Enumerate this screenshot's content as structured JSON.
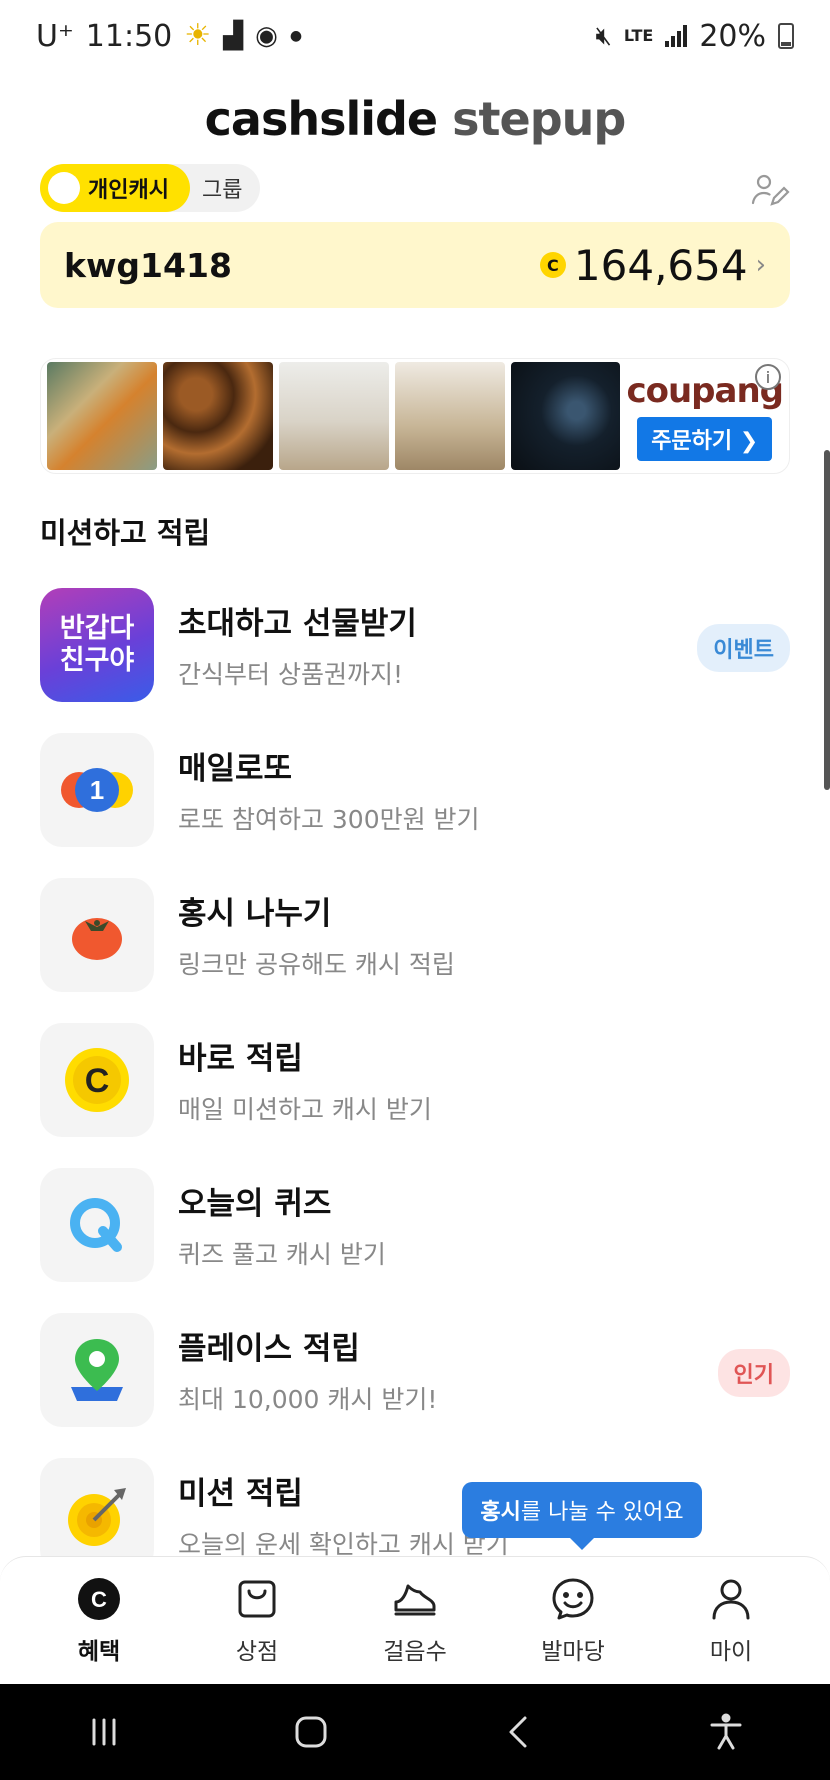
{
  "status_bar": {
    "carrier": "U⁺",
    "time": "11:50",
    "network": "LTE",
    "battery": "20%"
  },
  "header": {
    "title_part1": "cashslide",
    "title_part2": "stepup"
  },
  "segment": {
    "active": "개인캐시",
    "inactive": "그룹"
  },
  "account": {
    "user_id": "kwg1418",
    "coin_symbol": "C",
    "balance": "164,654"
  },
  "ad": {
    "brand": "coupang",
    "cta": "주문하기 ❯",
    "info": "i"
  },
  "section": {
    "title": "미션하고 적립"
  },
  "missions": [
    {
      "title": "초대하고 선물받기",
      "subtitle": "간식부터 상품권까지!",
      "badge": "이벤트",
      "icon": "invite-friend-icon",
      "icon_text": "반갑다\n친구야"
    },
    {
      "title": "매일로또",
      "subtitle": "로또 참여하고 300만원 받기",
      "icon": "lotto-icon",
      "icon_text": "1"
    },
    {
      "title": "홍시 나누기",
      "subtitle": "링크만 공유해도 캐시 적립",
      "icon": "persimmon-icon"
    },
    {
      "title": "바로 적립",
      "subtitle": "매일 미션하고 캐시 받기",
      "icon": "cash-coin-icon",
      "icon_text": "C"
    },
    {
      "title": "오늘의 퀴즈",
      "subtitle": "퀴즈 풀고 캐시 받기",
      "icon": "quiz-icon",
      "icon_text": "Q"
    },
    {
      "title": "플레이스 적립",
      "subtitle": "최대 10,000 캐시 받기!",
      "badge": "인기",
      "icon": "map-pin-icon"
    },
    {
      "title": "미션 적립",
      "subtitle": "오늘의 운세 확인하고 캐시 받기",
      "icon": "target-icon"
    }
  ],
  "tooltip": {
    "bold": "홍시",
    "rest": "를 나눌 수 있어요"
  },
  "bottom_nav": [
    {
      "label": "혜택",
      "icon": "benefit-coin-icon",
      "active": true
    },
    {
      "label": "상점",
      "icon": "shopping-bag-icon"
    },
    {
      "label": "걸음수",
      "icon": "sneaker-icon"
    },
    {
      "label": "발마당",
      "icon": "smile-chat-icon"
    },
    {
      "label": "마이",
      "icon": "person-icon"
    }
  ],
  "colors": {
    "accent_yellow": "#ffe100",
    "balance_card_bg": "#fff7cc",
    "tooltip_blue": "#2b7de0"
  }
}
